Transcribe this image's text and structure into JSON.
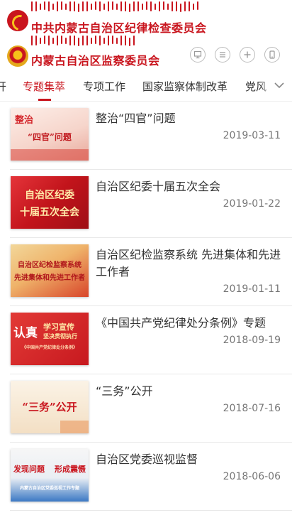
{
  "header": {
    "org_name_1": "中共内蒙古自治区纪律检查委员会",
    "org_name_2": "内蒙古自治区监察委员会",
    "tools": [
      "monitor-icon",
      "menu-icon",
      "plus-icon",
      "mobile-icon"
    ]
  },
  "nav": {
    "tabs": [
      {
        "label": "开"
      },
      {
        "label": "专题集萃",
        "active": true
      },
      {
        "label": "专项工作"
      },
      {
        "label": "国家监察体制改革"
      },
      {
        "label": "党风"
      }
    ]
  },
  "articles": [
    {
      "title": "整治“四官”问题",
      "date": "2019-03-11",
      "thumb_text": [
        "整治",
        "“四官”问题"
      ]
    },
    {
      "title": "自治区纪委十届五次全会",
      "date": "2019-01-22",
      "thumb_text": [
        "自治区纪委",
        "十届五次全会"
      ]
    },
    {
      "title": "自治区纪检监察系统 先进集体和先进工作者",
      "date": "2019-01-11",
      "thumb_text": [
        "自治区纪检监察系统",
        "先进集体和先进工作者"
      ]
    },
    {
      "title": "《中国共产党纪律处分条例》专题",
      "date": "2018-09-19",
      "thumb_text": [
        "认真",
        "学习宣传",
        "坚决贯彻执行",
        "《中国共产党纪律处分条例》"
      ]
    },
    {
      "title": "“三务”公开",
      "date": "2018-07-16",
      "thumb_text": [
        "“三务”公开"
      ]
    },
    {
      "title": "自治区党委巡视监督",
      "date": "2018-06-06",
      "thumb_text": [
        "发现问题",
        "形成震慑",
        "内蒙古自治区党委巡视工作专题"
      ]
    }
  ],
  "colors": {
    "accent": "#c9151e"
  }
}
